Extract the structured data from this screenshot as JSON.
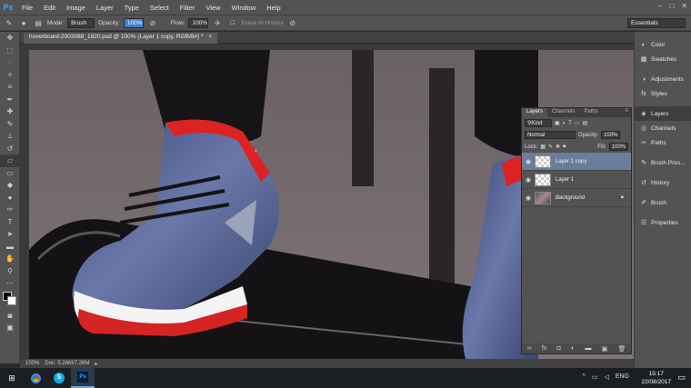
{
  "app": {
    "logo": "Ps"
  },
  "menu": [
    "File",
    "Edit",
    "Image",
    "Layer",
    "Type",
    "Select",
    "Filter",
    "View",
    "Window",
    "Help"
  ],
  "window_controls": [
    "–",
    "□",
    "✕"
  ],
  "options": {
    "mode_label": "Mode:",
    "mode_value": "Brush",
    "opacity_label": "Opacity:",
    "opacity_value": "100%",
    "flow_label": "Flow:",
    "flow_value": "100%",
    "erase_history": "Erase to History",
    "workspace": "Essentials"
  },
  "document": {
    "tab_title": "hoverboard-2003088_1920.psd @ 100% (Layer 1 copy, RGB/8#) *",
    "close": "×"
  },
  "status": {
    "zoom": "100%",
    "doc": "Doc: 5.26M/7.26M"
  },
  "dock": [
    {
      "label": "Color",
      "icon": "color-icon"
    },
    {
      "label": "Swatches",
      "icon": "swatches-icon"
    },
    {
      "label": "Adjustments",
      "icon": "adjustments-icon"
    },
    {
      "label": "Styles",
      "icon": "styles-icon"
    },
    {
      "label": "Layers",
      "icon": "layers-icon"
    },
    {
      "label": "Channels",
      "icon": "channels-icon"
    },
    {
      "label": "Paths",
      "icon": "paths-icon"
    },
    {
      "label": "Brush Pres...",
      "icon": "brush-presets-icon"
    },
    {
      "label": "History",
      "icon": "history-icon"
    },
    {
      "label": "Brush",
      "icon": "brush-icon"
    },
    {
      "label": "Properties",
      "icon": "properties-icon"
    }
  ],
  "layers_panel": {
    "tabs": [
      "Layers",
      "Channels",
      "Paths"
    ],
    "kind": "Kind",
    "blend_mode": "Normal",
    "opacity_label": "Opacity:",
    "opacity_value": "100%",
    "lock_label": "Lock:",
    "fill_label": "Fill:",
    "fill_value": "100%",
    "layers": [
      {
        "name": "Layer 1 copy",
        "selected": true
      },
      {
        "name": "Layer 1",
        "selected": false
      },
      {
        "name": "Background",
        "selected": false
      }
    ]
  },
  "taskbar": {
    "lang": "ENG",
    "time": "15:17",
    "date": "22/08/2017"
  }
}
